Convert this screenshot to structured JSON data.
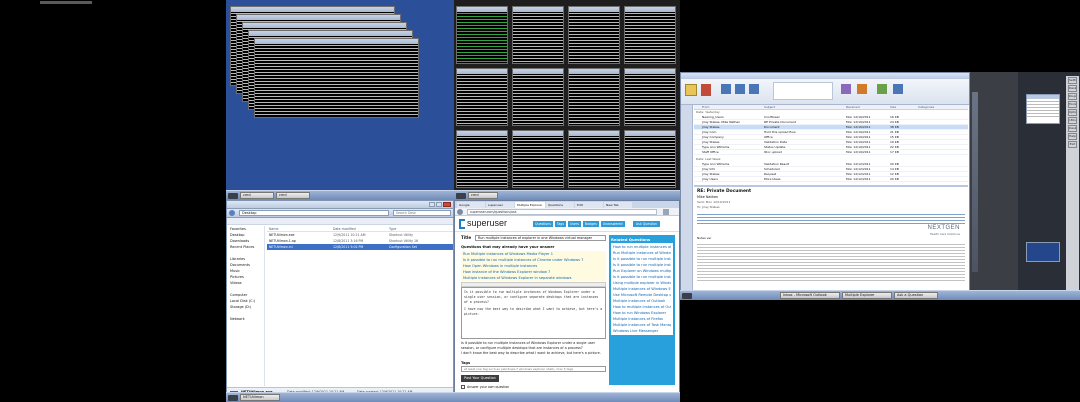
{
  "topbar": {
    "chip_color": "#5a5a5a"
  },
  "explorer": {
    "address": "Desktop",
    "search_placeholder": "Search Desk",
    "columns": [
      "Name",
      "Date modified",
      "Type"
    ],
    "files": [
      {
        "name": "NETUtilmon.exe",
        "date": "12/9/2011 10:21 AM",
        "type": "Shortcut Utility"
      },
      {
        "name": "NETUtilmon.1.ap",
        "date": "12/8/2011 3:16 PM",
        "type": "Shortcut Utility 16"
      },
      {
        "name": "NETUtilmon.ini",
        "date": "12/8/2011 9:02 PM",
        "type": "Configuration Set"
      }
    ],
    "sidebar": [
      "Favorites",
      "Desktop",
      "Downloads",
      "Recent Places",
      "",
      "Libraries",
      "Documents",
      "Music",
      "Pictures",
      "Videos",
      "",
      "Computer",
      "Local Disk (C:)",
      "Storage (D:)",
      "",
      "Network"
    ],
    "status_name": "NETUtilmon.exe",
    "status_type": "Shortcut",
    "status_date": "Date modified: 12/9/2011 10:21 AM",
    "status_size": "Size: 2 KB",
    "status_created": "Date created: 12/9/2011 10:21 AM"
  },
  "browser": {
    "tabs": [
      "Google",
      "superuser",
      "Multiple Explorer",
      "Questions",
      "Edit",
      "New Tab"
    ],
    "url": "superuser.com/questions/ask",
    "logo": "superuser",
    "nav": [
      "Questions",
      "Tags",
      "Users",
      "Badges",
      "Unanswered"
    ],
    "ask_button": "Ask Question",
    "title_label": "Title",
    "title_value": "Run multiple instances of explorer in one Windows virtual manager",
    "similar_heading": "Questions that may already have your answer",
    "similar": [
      "Run Multiple instances of Windows Media Player 1",
      "Is it possible to run multiple instances of Chrome under Windows 7",
      "How Open Windows in multiple instances",
      "How instance of the Windows Explorer window 7",
      "Multiple instances of Windows Explorer in separate windows"
    ],
    "body_text": "Is it possible to run multiple instances of Windows Explorer under a single user session, or configure separate desktops that are instances of a process?",
    "body_text2": "I have now the best way to describe what I want to achieve, but here's a picture.",
    "preview_text": "Is it possible to run multiple instances of Windows Explorer under a single user session, or configure multiple desktops that are instances of a process?",
    "preview_text2": "I don't know the best way to describe what I want to achieve, but here's a picture.",
    "tags_label": "Tags",
    "tags_placeholder": "at least one tag such as (windows-7 windows explorer shell), max 5 tags",
    "post_button": "Post Your Question",
    "answer_own": "Answer your own question",
    "related_heading": "Related Questions",
    "related": [
      "How to run multiple instances of Skype Simultaneously",
      "Run Multiple instances of Windows Media Player",
      "Is it possible to run multiple instances of Firefox",
      "Is it possible to run multiple instances of Outlook",
      "Run Explorer on Windows multiple instances",
      "Is it possible to run multiple instances of Chrome",
      "Using multiple explorer in Windows",
      "Multiple instances of Windows Explorer",
      "Use Microsoft Remote Desktop on Windows",
      "Multiple instances of Outlook",
      "How to multiple instances of Outlook at the same time",
      "How to run Windows Explorer",
      "Multiple instances of Firefox",
      "Multiple instances of Task Manager",
      "Windows Live Messenger"
    ]
  },
  "outlook": {
    "folder_heading": "Date: Yesterday",
    "columns": [
      "From",
      "Subject",
      "Received",
      "Size",
      "Categories"
    ],
    "rows": [
      {
        "from": "Nearing_Users",
        "subject": "Coolflower",
        "received": "Mon 12/19/2011",
        "size": "16 KB"
      },
      {
        "from": "Jiray Stakes, Mike Nathen",
        "subject": "RE Private Document",
        "received": "Mon 12/19/2011",
        "size": "24 KB"
      },
      {
        "from": "Jiray Stakes",
        "subject": "Document",
        "received": "Mon 12/19/2011",
        "size": "38 KB"
      },
      {
        "from": "Jiray Com",
        "subject": "Hold this upload flow",
        "received": "Mon 12/19/2011",
        "size": "21 KB"
      },
      {
        "from": "Jiray Company",
        "subject": "Office",
        "received": "Mon 12/19/2011",
        "size": "15 KB"
      },
      {
        "from": "Jiray Stakes",
        "subject": "Validation Data",
        "received": "Mon 12/19/2011",
        "size": "19 KB"
      },
      {
        "from": "Type Ann Williams",
        "subject": "Status Update",
        "received": "Mon 12/19/2011",
        "size": "22 KB"
      },
      {
        "from": "Staff Office",
        "subject": "IDoc upload",
        "received": "Mon 12/19/2011",
        "size": "17 KB"
      }
    ],
    "older_heading": "Date: Last Week",
    "rows2": [
      {
        "from": "Type Ann Williams",
        "subject": "Validation Result",
        "received": "Mon 12/12/2011",
        "size": "29 KB"
      },
      {
        "from": "Jiray Info",
        "subject": "Scheduled",
        "received": "Mon 12/12/2011",
        "size": "14 KB"
      },
      {
        "from": "Jiray Stakes",
        "subject": "Request",
        "received": "Mon 12/12/2011",
        "size": "12 KB"
      },
      {
        "from": "Jiray Users",
        "subject": "More Ideas",
        "received": "Mon 12/12/2011",
        "size": "20 KB"
      }
    ],
    "reading_title": "RE: Private Document",
    "reading_from": "Mike Nathen",
    "reading_sent": "Sent: Mon 12/19/2011",
    "reading_to": "To: Jiray Stakes",
    "reading_body": "Notes ver",
    "brand": "NEXTGEN",
    "brand_sub": "Health Care Solutions",
    "status_left": "Items: 342",
    "status_right": "All folders are up to date."
  },
  "taskbar": {
    "left_items": [
      "NETUtilmon",
      "cmd",
      "cmd",
      "cmd"
    ],
    "right_items": [
      "Inbox - Microsoft Outlook",
      "Multiple Explorer",
      "Ask a Question"
    ]
  },
  "rightpanel": {
    "items": [
      "Settings",
      "Desktop",
      "Display",
      "Tools",
      "Options",
      "Utils",
      "Desktop",
      "Help",
      "Exit"
    ]
  }
}
